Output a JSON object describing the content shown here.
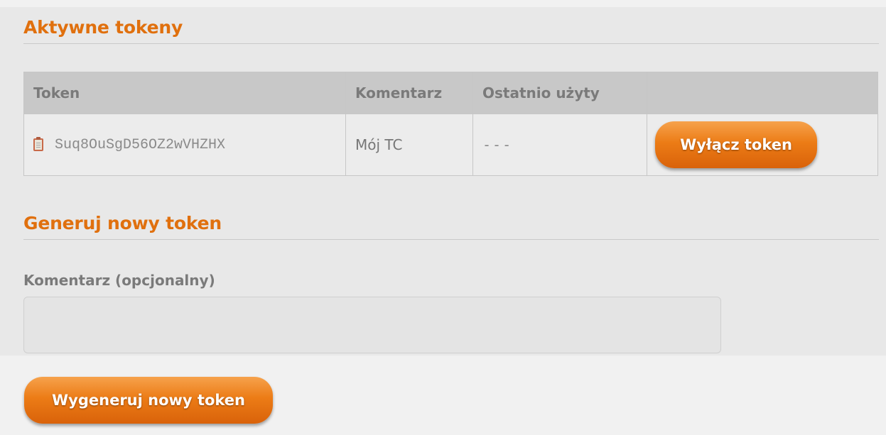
{
  "active_section": {
    "title": "Aktywne tokeny",
    "columns": [
      "Token",
      "Komentarz",
      "Ostatnio użyty",
      ""
    ],
    "rows": [
      {
        "token": "Suq8OuSgD56OZ2wVHZHX",
        "comment": "Mój TC",
        "last_used": "---",
        "action_label": "Wyłącz token"
      }
    ]
  },
  "generate_section": {
    "title": "Generuj nowy token",
    "comment_label": "Komentarz (opcjonalny)",
    "comment_value": "",
    "comment_placeholder": "",
    "submit_label": "Wygeneruj nowy token"
  },
  "colors": {
    "accent": "#e0700e",
    "button_top": "#f6a24c",
    "button_bottom": "#d9620a",
    "panel_bg": "#e8e8e8",
    "table_header_bg": "#c8c8c8"
  },
  "icons": {
    "token_icon": "clipboard-icon"
  }
}
